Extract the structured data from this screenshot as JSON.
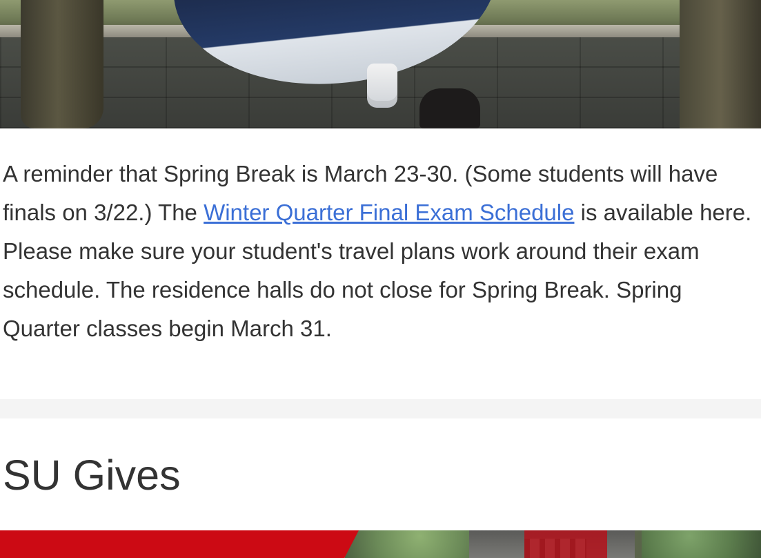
{
  "notice": {
    "text_before": "A reminder that Spring Break is March 23-30. (Some students will have finals on 3/22.) The ",
    "link_text": "Winter Quarter Final Exam Schedule",
    "text_after": " is available here. Please make sure your student's travel plans work around their exam schedule. The residence halls do not close for Spring Break. Spring Quarter classes begin March 31."
  },
  "section": {
    "title": "SU Gives"
  },
  "colors": {
    "link": "#3b6fd6",
    "brand_red": "#cc0a14",
    "divider": "#f4f4f4",
    "text": "#333333"
  }
}
